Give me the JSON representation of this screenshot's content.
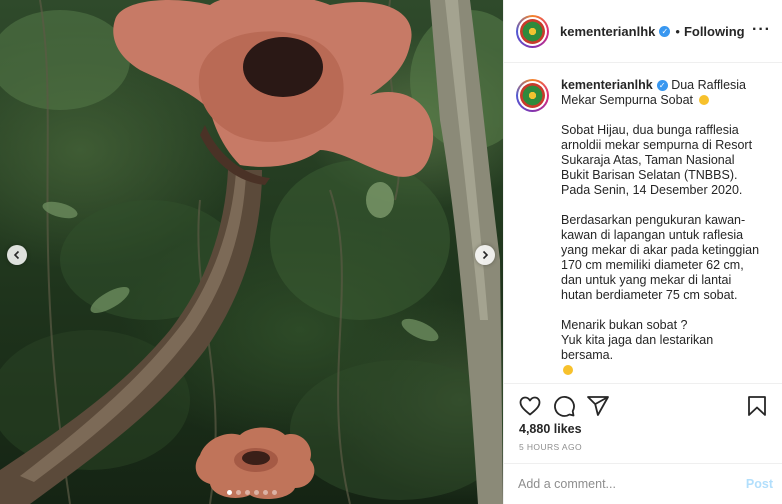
{
  "post": {
    "username": "kementerianlhk",
    "follow_label": "Following",
    "separator": "•",
    "more_label": "···",
    "verified_glyph": "✓",
    "caption": {
      "title": "Dua Rafflesia Mekar Sempurna Sobat",
      "paragraph1": "Sobat Hijau, dua bunga rafflesia arnoldii mekar sempurna di Resort Sukaraja Atas, Taman Nasional Bukit Barisan Selatan (TNBBS). Pada Senin, 14 Desember 2020.",
      "paragraph2": "Berdasarkan pengukuran kawan-kawan di lapangan untuk raflesia yang mekar di akar pada ketinggian 170 cm memiliki diameter 62 cm, dan untuk yang mekar di lantai hutan berdiameter 75 cm sobat.",
      "paragraph3_line1": "Menarik bukan sobat ?",
      "paragraph3_line2": "Yuk kita jaga dan lestarikan bersama."
    },
    "likes": "4,880 likes",
    "time": "5 HOURS AGO",
    "comment_placeholder": "Add a comment...",
    "post_label": "Post",
    "carousel": {
      "slides": 6,
      "active": 0
    }
  },
  "icons": {
    "like": "heart-icon",
    "comment": "comment-icon",
    "share": "paper-plane-icon",
    "save": "bookmark-icon",
    "prev": "chevron-left-icon",
    "next": "chevron-right-icon"
  },
  "colors": {
    "verified": "#3897f0",
    "post_disabled": "#b2dffc",
    "flower": "#c77a66"
  }
}
